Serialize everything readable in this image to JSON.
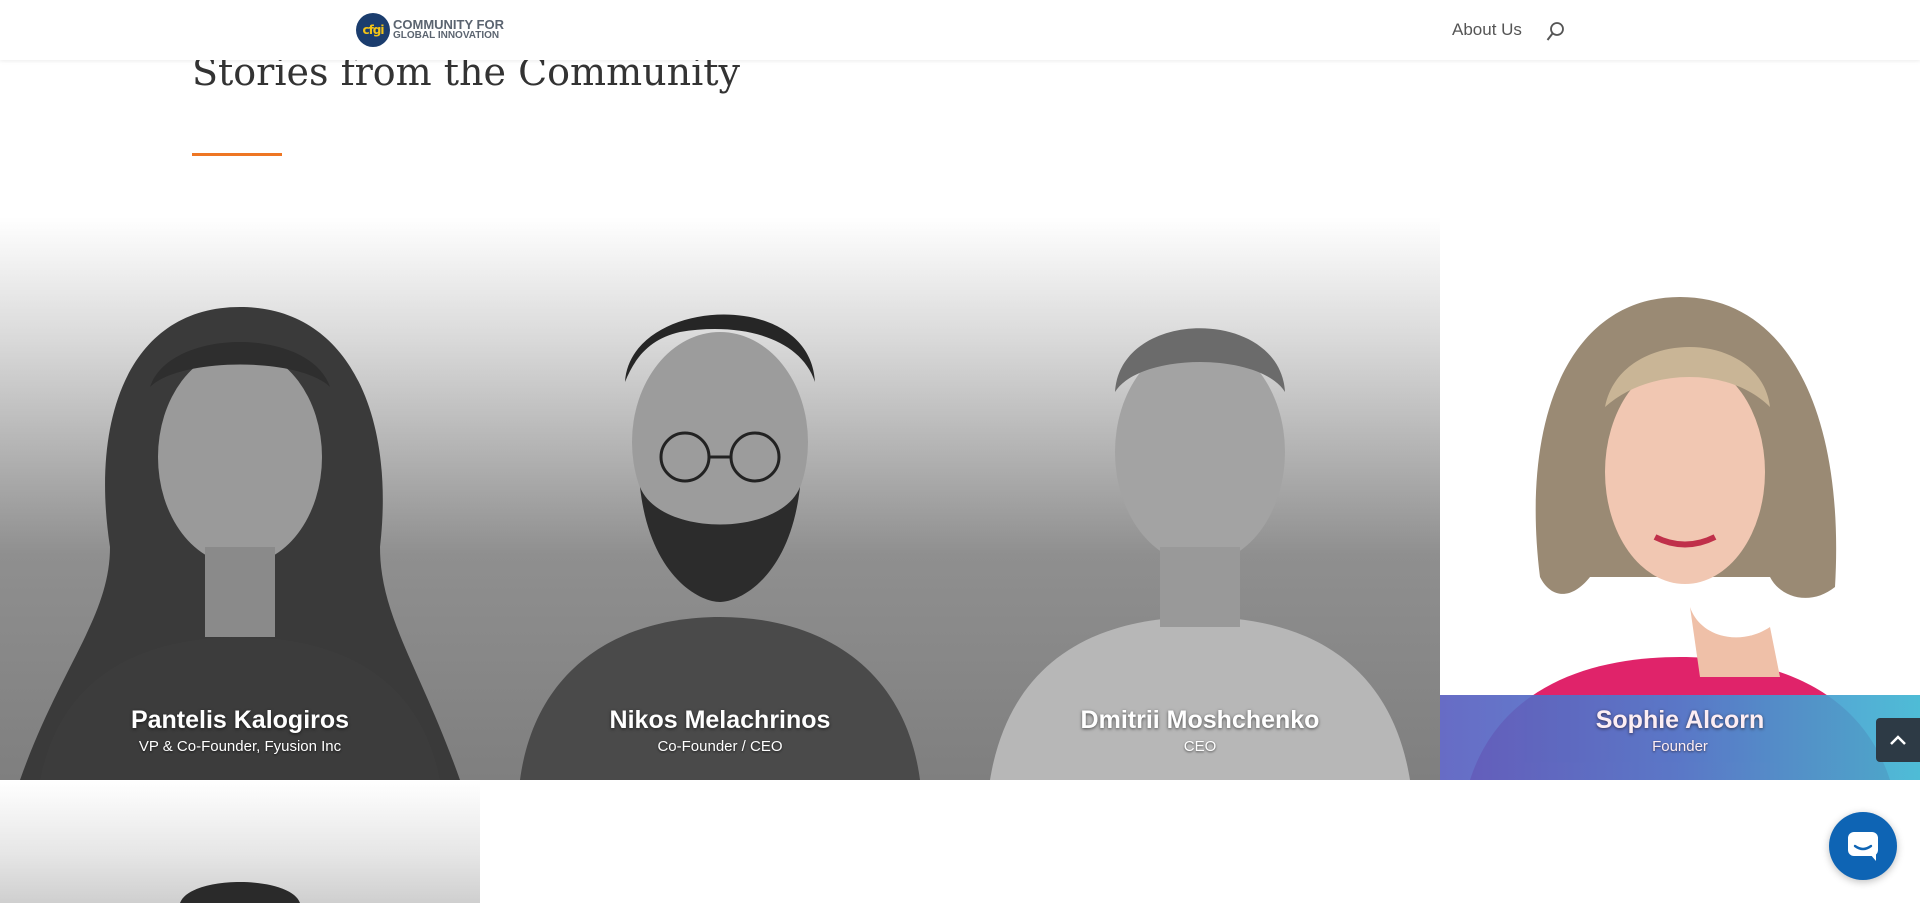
{
  "header": {
    "logo_text_line1": "COMMUNITY FOR",
    "logo_text_line2": "GLOBAL INNOVATION",
    "logo_mark": "cfgi",
    "nav": [
      {
        "label": "About Us"
      }
    ],
    "search_icon": "search-icon"
  },
  "section": {
    "title": "Stories from the Community",
    "accent_color": "#ee7623"
  },
  "cards": [
    {
      "name": "Pantelis Kalogiros",
      "role": "VP & Co-Founder, Fyusion Inc"
    },
    {
      "name": "Nikos Melachrinos",
      "role": "Co-Founder / CEO"
    },
    {
      "name": "Dmitrii Moshchenko",
      "role": "CEO"
    },
    {
      "name": "Sophie Alcorn",
      "role": "Founder"
    }
  ],
  "floating": {
    "back_to_top_icon": "chevron-up-icon",
    "chat_icon": "chat-icon"
  },
  "colors": {
    "brand_navy": "#1b3d6e",
    "brand_yellow": "#f2c316",
    "chat_blue": "#0e64b4",
    "featured_gradient_start": "#5a5fc0",
    "featured_gradient_end": "#3fb6d2"
  }
}
